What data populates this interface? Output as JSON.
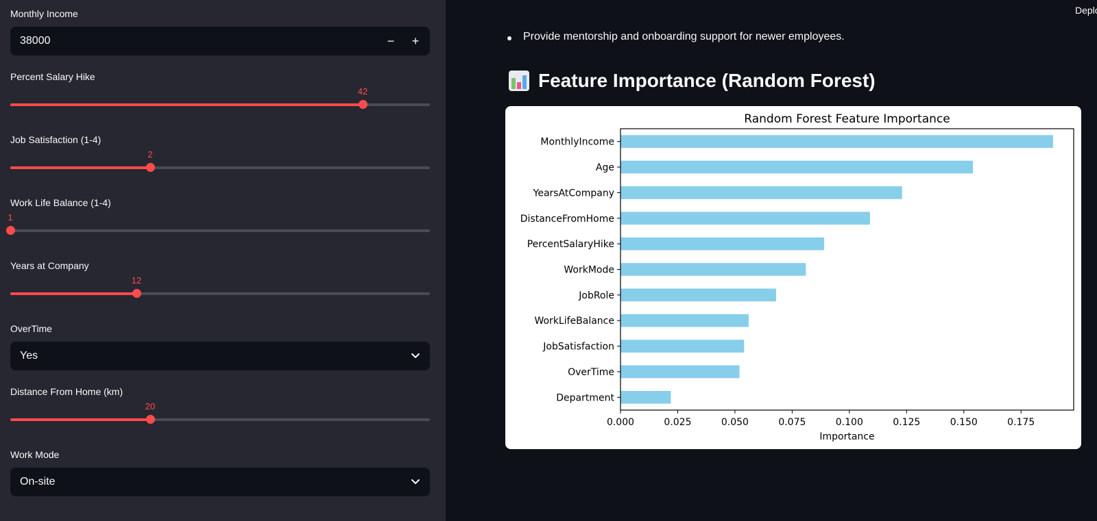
{
  "sidebar": {
    "monthly_income": {
      "label": "Monthly Income",
      "value": "38000",
      "minus": "−",
      "plus": "+"
    },
    "percent_salary_hike": {
      "label": "Percent Salary Hike",
      "value": "42",
      "fraction": 0.84
    },
    "job_satisfaction": {
      "label": "Job Satisfaction (1-4)",
      "value": "2",
      "fraction": 0.333
    },
    "work_life_balance": {
      "label": "Work Life Balance (1-4)",
      "value": "1",
      "fraction": 0.0
    },
    "years_at_company": {
      "label": "Years at Company",
      "value": "12",
      "fraction": 0.3
    },
    "overtime": {
      "label": "OverTime",
      "value": "Yes"
    },
    "distance_from_home": {
      "label": "Distance From Home (km)",
      "value": "20",
      "fraction": 0.333
    },
    "work_mode": {
      "label": "Work Mode",
      "value": "On-site"
    }
  },
  "header": {
    "deploy_label": "Deploy"
  },
  "main": {
    "bullet_text": "Provide mentorship and onboarding support for newer employees.",
    "section_title": "Feature Importance (Random Forest)",
    "section_icon": "bar-chart-icon"
  },
  "colors": {
    "accent": "#ff4b4b",
    "bar": "#87ceeb",
    "sidebar_bg": "#262730",
    "main_bg": "#0e1117"
  },
  "chart_data": {
    "type": "bar",
    "orientation": "horizontal",
    "title": "Random Forest Feature Importance",
    "xlabel": "Importance",
    "ylabel": "",
    "categories": [
      "MonthlyIncome",
      "Age",
      "YearsAtCompany",
      "DistanceFromHome",
      "PercentSalaryHike",
      "WorkMode",
      "JobRole",
      "WorkLifeBalance",
      "JobSatisfaction",
      "OverTime",
      "Department"
    ],
    "values": [
      0.189,
      0.154,
      0.123,
      0.109,
      0.089,
      0.081,
      0.068,
      0.056,
      0.054,
      0.052,
      0.022
    ],
    "xlim": [
      0,
      0.198
    ],
    "xticks": [
      "0.000",
      "0.025",
      "0.050",
      "0.075",
      "0.100",
      "0.125",
      "0.150",
      "0.175"
    ],
    "xtick_values": [
      0,
      0.025,
      0.05,
      0.075,
      0.1,
      0.125,
      0.15,
      0.175
    ],
    "grid": false
  }
}
